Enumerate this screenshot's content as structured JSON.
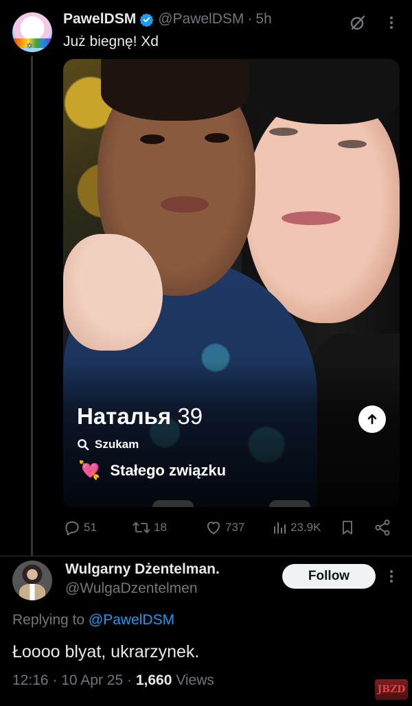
{
  "tweet": {
    "author_name": "PawelDSM",
    "author_handle": "@PawelDSM",
    "separator": "·",
    "time": "5h",
    "text": "Już biegnę! Xd",
    "media": {
      "profile_name": "Наталья",
      "profile_age": "39",
      "search_label": "Szukam",
      "looking_for": "Stałego związku",
      "heart_emoji": "💘"
    },
    "stats": {
      "replies": "51",
      "reposts": "18",
      "likes": "737",
      "views": "23.9K"
    }
  },
  "reply": {
    "author_name": "Wulgarny Dżentelman.",
    "author_handle": "@WulgaDzentelmen",
    "follow_label": "Follow",
    "replying_prefix": "Replying to",
    "replying_handle": "@PawelDSM",
    "text": "Łoooo blyat, ukrarzynek.",
    "time": "12:16",
    "date": "10 Apr 25",
    "views_count": "1,660",
    "views_label": "Views",
    "separator": "·"
  },
  "watermark": "JBZD",
  "colors": {
    "background": "#000000",
    "text": "#e7e9ea",
    "muted": "#71767b",
    "link": "#1d9bf0",
    "verified": "#1d9bf0"
  }
}
